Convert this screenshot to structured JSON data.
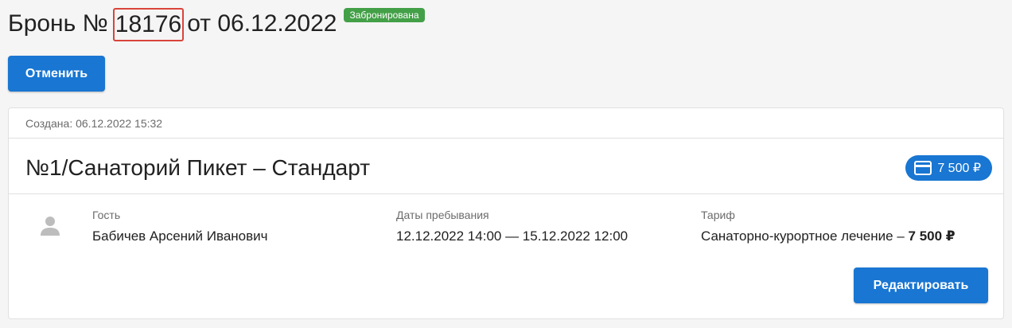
{
  "header": {
    "title_prefix": "Бронь №",
    "booking_number": "18176",
    "title_date": "от 06.12.2022",
    "status": "Забронирована"
  },
  "actions": {
    "cancel_label": "Отменить"
  },
  "card": {
    "created": "Создана: 06.12.2022 15:32",
    "room_title": "№1/Санаторий Пикет – Стандарт",
    "price": "7 500 ₽",
    "guest": {
      "label": "Гость",
      "value": "Бабичев Арсений Иванович"
    },
    "dates": {
      "label": "Даты пребывания",
      "value": "12.12.2022 14:00 — 15.12.2022 12:00"
    },
    "tariff": {
      "label": "Тариф",
      "name": "Санаторно-курортное лечение –",
      "price": "7 500 ₽"
    },
    "edit_label": "Редактировать"
  },
  "icons": {
    "price": "credit-card-icon",
    "guest": "user-icon"
  },
  "colors": {
    "accent": "#1976d2",
    "status": "#43a047",
    "highlight": "#d9443b"
  }
}
